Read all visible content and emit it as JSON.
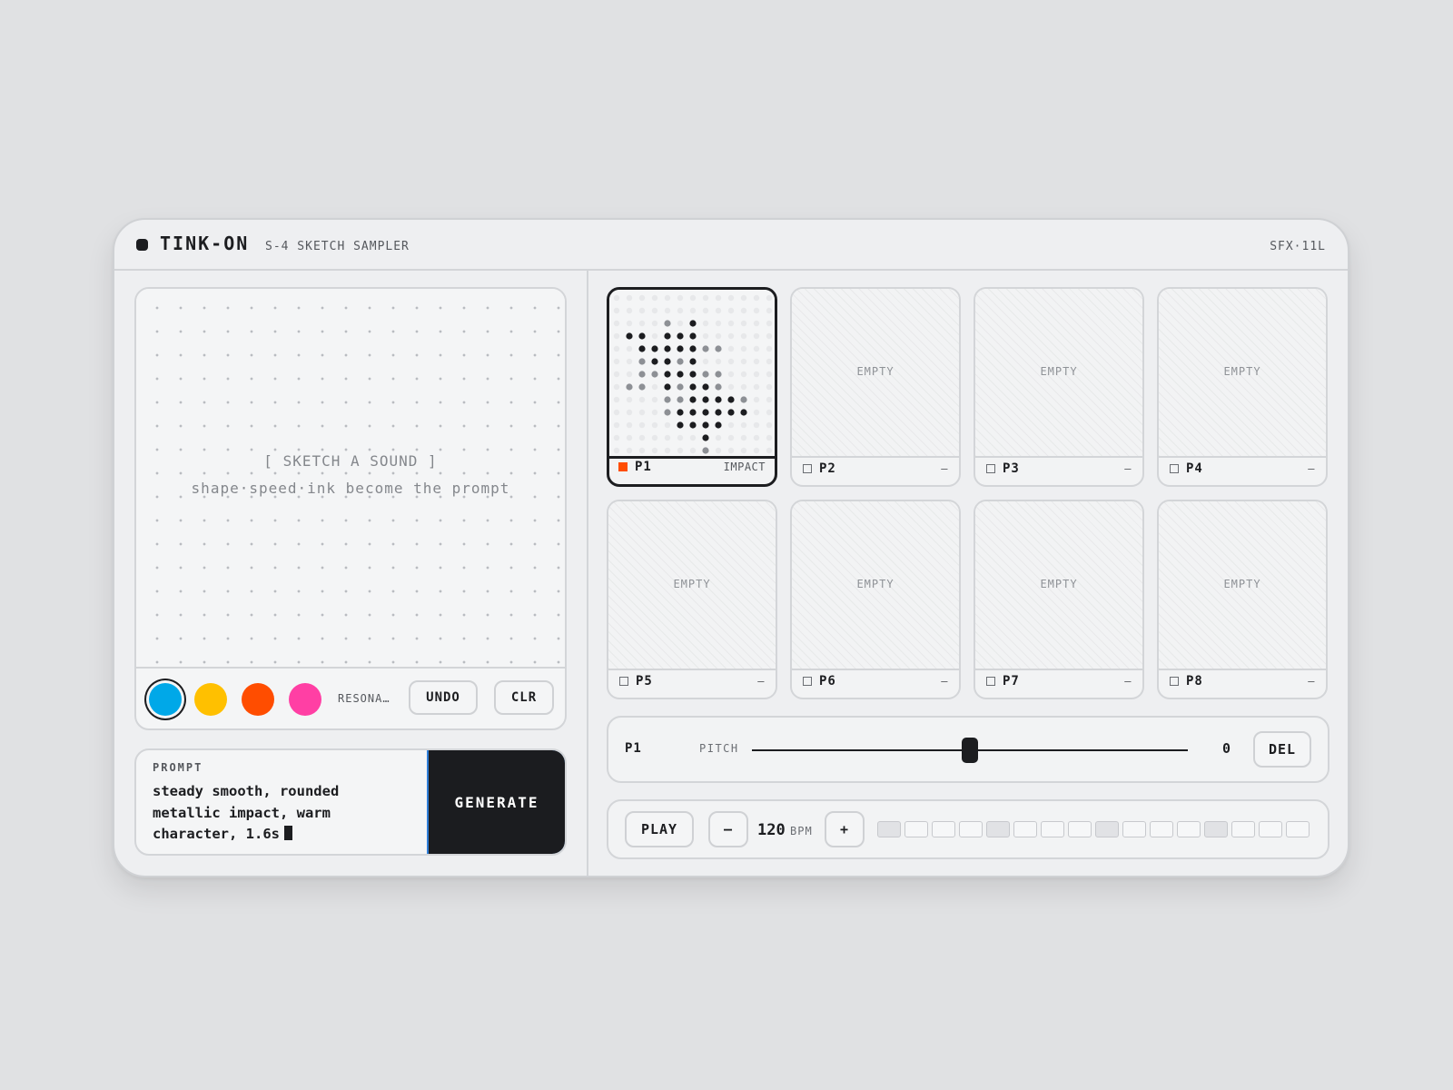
{
  "header": {
    "brand": "TINK-ON",
    "subtitle": "S-4 SKETCH SAMPLER",
    "model": "SFX·11L"
  },
  "sketch": {
    "hint_line1": "[ SKETCH A SOUND ]",
    "hint_line2": "shape·speed·ink become the prompt"
  },
  "inks": [
    {
      "name": "cyan",
      "color": "#00a8e8",
      "selected": true
    },
    {
      "name": "yellow",
      "color": "#ffc000",
      "selected": false
    },
    {
      "name": "orange",
      "color": "#ff4d00",
      "selected": false
    },
    {
      "name": "pink",
      "color": "#ff3fa4",
      "selected": false
    }
  ],
  "toolbar": {
    "ink_label": "RESONA…",
    "undo_label": "UNDO",
    "clear_label": "CLR"
  },
  "prompt": {
    "label": "PROMPT",
    "text": "steady smooth, rounded metallic impact, warm character, 1.6s",
    "generate_label": "GENERATE"
  },
  "pads": [
    {
      "id": "P1",
      "tag": "IMPACT",
      "empty_label": "",
      "active": true
    },
    {
      "id": "P2",
      "tag": "–",
      "empty_label": "EMPTY",
      "active": false
    },
    {
      "id": "P3",
      "tag": "–",
      "empty_label": "EMPTY",
      "active": false
    },
    {
      "id": "P4",
      "tag": "–",
      "empty_label": "EMPTY",
      "active": false
    },
    {
      "id": "P5",
      "tag": "–",
      "empty_label": "EMPTY",
      "active": false
    },
    {
      "id": "P6",
      "tag": "–",
      "empty_label": "EMPTY",
      "active": false
    },
    {
      "id": "P7",
      "tag": "–",
      "empty_label": "EMPTY",
      "active": false
    },
    {
      "id": "P8",
      "tag": "–",
      "empty_label": "EMPTY",
      "active": false
    }
  ],
  "pitch": {
    "pad": "P1",
    "label": "PITCH",
    "value": "0",
    "slider_fraction": 0.5,
    "delete_label": "DEL"
  },
  "transport": {
    "play_label": "PLAY",
    "minus_label": "–",
    "plus_label": "+",
    "bpm": "120",
    "bpm_unit": "BPM",
    "steps": [
      true,
      false,
      false,
      false,
      true,
      false,
      false,
      false,
      true,
      false,
      false,
      false,
      true,
      false,
      false,
      false
    ]
  },
  "colors": {
    "accent": "#ff4d00",
    "dark": "#1c1d20",
    "generate_border": "#2f7ed8"
  }
}
